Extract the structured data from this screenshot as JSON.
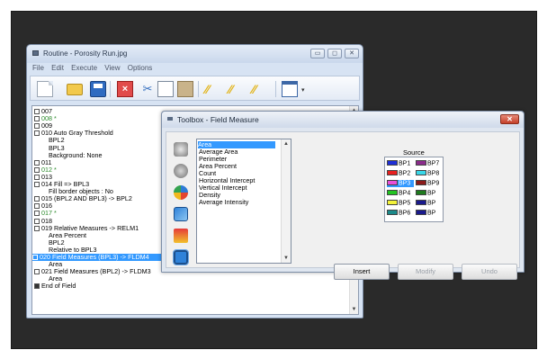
{
  "routine_window": {
    "title": "Routine - Porosity Run.jpg",
    "controls": {
      "minimize": "▭",
      "maximize": "◻",
      "close": "✕"
    },
    "menu": [
      "File",
      "Edit",
      "Execute",
      "View",
      "Options"
    ],
    "toolbar_icons": [
      "new-file-icon",
      "open-folder-icon",
      "save-icon",
      "delete-icon",
      "cut-icon",
      "copy-icon",
      "paste-icon",
      "binary-op-icon",
      "binary-op-icon",
      "binary-op-icon",
      "window-icon"
    ],
    "toolbar_caret": "▾",
    "steps": [
      {
        "code": "007",
        "text": "",
        "color": "normal"
      },
      {
        "code": "008",
        "text": "*",
        "color": "green"
      },
      {
        "code": "009",
        "text": "",
        "color": "normal"
      },
      {
        "code": "010",
        "text": "Auto Gray Threshold",
        "color": "normal",
        "sub": [
          "BPL2",
          "BPL3",
          "Background: None"
        ]
      },
      {
        "code": "011",
        "text": "",
        "color": "normal"
      },
      {
        "code": "012",
        "text": "*",
        "color": "green"
      },
      {
        "code": "013",
        "text": "",
        "color": "normal"
      },
      {
        "code": "014",
        "text": "Fill => BPL3",
        "color": "normal",
        "sub": [
          "Fill border objects : No"
        ]
      },
      {
        "code": "015",
        "text": "(BPL2 AND BPL3) -> BPL2",
        "color": "normal"
      },
      {
        "code": "016",
        "text": "",
        "color": "normal"
      },
      {
        "code": "017",
        "text": "*",
        "color": "green"
      },
      {
        "code": "018",
        "text": "",
        "color": "normal"
      },
      {
        "code": "019",
        "text": "Relative Measures -> RELM1",
        "color": "normal",
        "sub": [
          "Area Percent",
          "BPL2",
          "Relative to BPL3"
        ]
      },
      {
        "code": "020",
        "text": "Field Measures (BPL3) -> FLDM4",
        "color": "selected",
        "sub": [
          "Area"
        ]
      },
      {
        "code": "021",
        "text": "Field Measures (BPL2) -> FLDM3",
        "color": "normal",
        "sub": [
          "Area"
        ]
      }
    ],
    "end_row": "End of Field",
    "scroll_up": "▲",
    "scroll_down": "▼"
  },
  "toolbox": {
    "title": "Toolbox - Field Measure",
    "close_label": "✕",
    "tools": [
      "camera-icon",
      "gear-icon",
      "color-wheel-icon",
      "image-process-icon",
      "measure-icon",
      "field-measure-icon"
    ],
    "measurements": [
      "Area",
      "Average Area",
      "Perimeter",
      "Area Percent",
      "Count",
      "Horizontal Intercept",
      "Vertical Intercept",
      "Density",
      "Average Intensity"
    ],
    "selected_measurement": "Area",
    "source_label": "Source",
    "bitplanes": [
      {
        "label": "BP1",
        "color": "#1f2fd6"
      },
      {
        "label": "BP7",
        "color": "#8b2c8b"
      },
      {
        "label": "BP2",
        "color": "#e62020"
      },
      {
        "label": "BP8",
        "color": "#39d7e8"
      },
      {
        "label": "BP3",
        "color": "#e84fd8",
        "selected": true
      },
      {
        "label": "BP9",
        "color": "#8b1a1a"
      },
      {
        "label": "BP4",
        "color": "#22c422"
      },
      {
        "label": "BP",
        "color": "#1e7a1e"
      },
      {
        "label": "BP5",
        "color": "#f2f23a"
      },
      {
        "label": "BP",
        "color": "#1a1a8c"
      },
      {
        "label": "BP6",
        "color": "#1c8a8a"
      },
      {
        "label": "BP",
        "color": "#1a1a8c"
      }
    ],
    "buttons": {
      "insert": "Insert",
      "modify": "Modify",
      "undo": "Undo"
    }
  }
}
